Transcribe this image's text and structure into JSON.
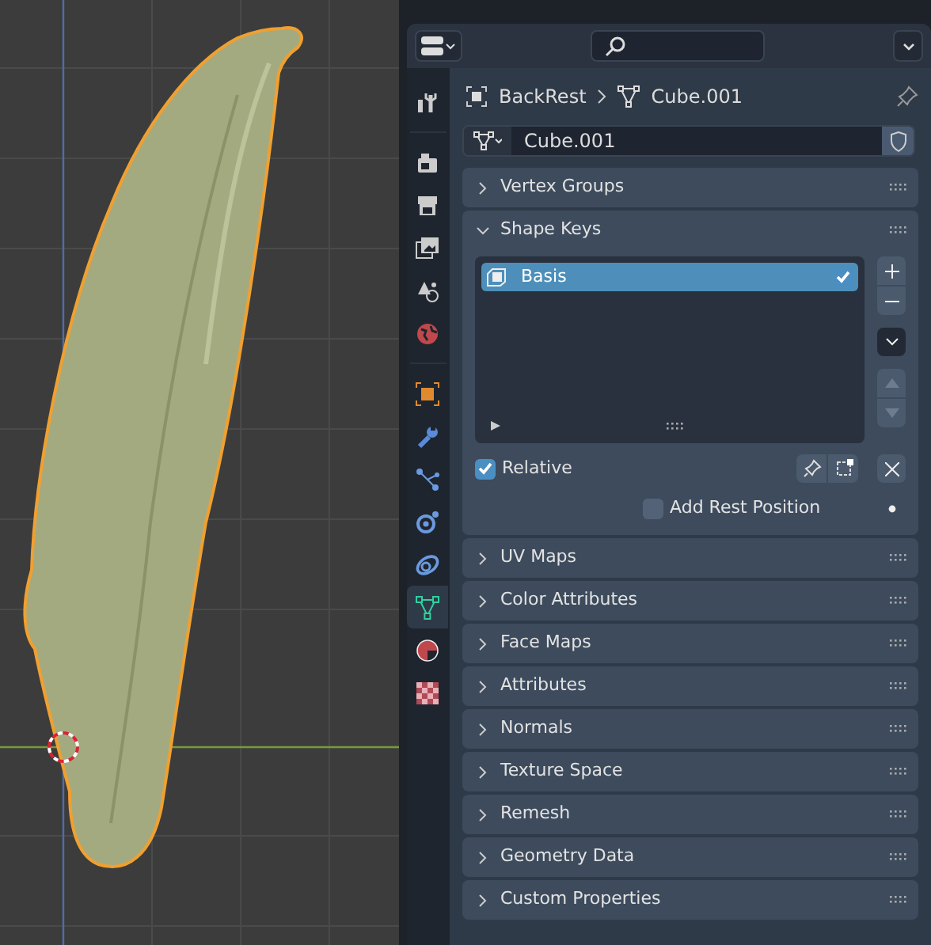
{
  "properties": {
    "tabs": [
      {
        "kind": "tool",
        "selected": false
      },
      {
        "kind": "render",
        "selected": false
      },
      {
        "kind": "output",
        "selected": false
      },
      {
        "kind": "view_layer",
        "selected": false
      },
      {
        "kind": "scene",
        "selected": false
      },
      {
        "kind": "world",
        "selected": false
      },
      {
        "kind": "object",
        "selected": false
      },
      {
        "kind": "modifiers",
        "selected": false
      },
      {
        "kind": "particles",
        "selected": false
      },
      {
        "kind": "physics",
        "selected": false
      },
      {
        "kind": "constraints",
        "selected": false
      },
      {
        "kind": "data",
        "selected": true
      },
      {
        "kind": "material",
        "selected": false
      },
      {
        "kind": "texture",
        "selected": false
      }
    ],
    "breadcrumb": [
      "BackRest",
      "Cube.001"
    ],
    "datablock": {
      "value": "Cube.001"
    },
    "panels": [
      {
        "title": "Vertex Groups",
        "expanded": false
      },
      {
        "title": "Shape Keys",
        "expanded": true,
        "shape_keys": [
          {
            "name": "Basis",
            "selected": true,
            "checked": true
          }
        ],
        "relative": {
          "label": "Relative",
          "checked": true
        },
        "add_rest_position": {
          "label": "Add Rest Position",
          "checked": false
        }
      },
      {
        "title": "UV Maps",
        "expanded": false
      },
      {
        "title": "Color Attributes",
        "expanded": false
      },
      {
        "title": "Face Maps",
        "expanded": false
      },
      {
        "title": "Attributes",
        "expanded": false
      },
      {
        "title": "Normals",
        "expanded": false
      },
      {
        "title": "Texture Space",
        "expanded": false
      },
      {
        "title": "Remesh",
        "expanded": false
      },
      {
        "title": "Geometry Data",
        "expanded": false
      },
      {
        "title": "Custom Properties",
        "expanded": false
      }
    ]
  }
}
